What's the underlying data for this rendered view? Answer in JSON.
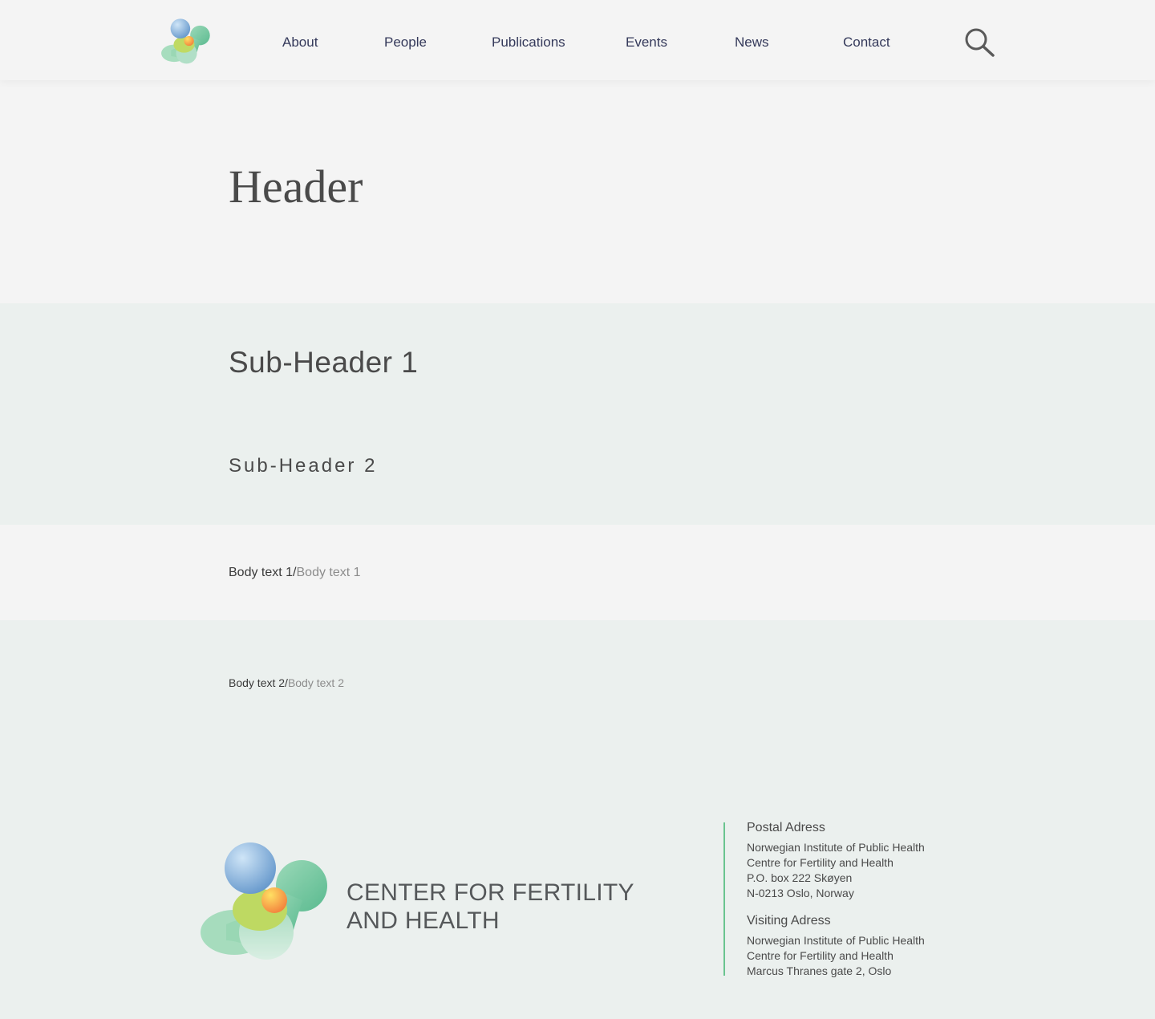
{
  "nav": {
    "items": [
      {
        "label": "About"
      },
      {
        "label": "People"
      },
      {
        "label": "Publications"
      },
      {
        "label": "Events"
      },
      {
        "label": "News"
      },
      {
        "label": "Contact"
      }
    ],
    "search_icon": "search-icon"
  },
  "hero": {
    "title": "Header"
  },
  "subheaders": {
    "sub1": "Sub-Header 1",
    "sub2": "Sub-Header 2"
  },
  "body_text_1": {
    "dark": "Body text 1/",
    "light": "Body text 1"
  },
  "body_text_2": {
    "dark": "Body text 2/",
    "light": "Body text 2"
  },
  "footer": {
    "org_name_line1": "CENTER FOR FERTILITY",
    "org_name_line2": "AND HEALTH",
    "postal": {
      "heading": "Postal Adress",
      "lines": [
        "Norwegian Institute of Public Health",
        "Centre for Fertility and Health",
        "P.O. box 222 Skøyen",
        "N-0213 Oslo, Norway"
      ]
    },
    "visiting": {
      "heading": "Visiting Adress",
      "lines": [
        "Norwegian Institute of Public Health",
        "Centre for Fertility and Health",
        "Marcus Thranes gate 2, Oslo"
      ]
    }
  },
  "colors": {
    "nav_text": "#34395a",
    "heading_text": "#4a4a4a",
    "body_light": "#8c8c8c",
    "light_band": "#f4f4f4",
    "tinted_band": "#ebf0ee",
    "accent_green": "#6ac48f"
  }
}
